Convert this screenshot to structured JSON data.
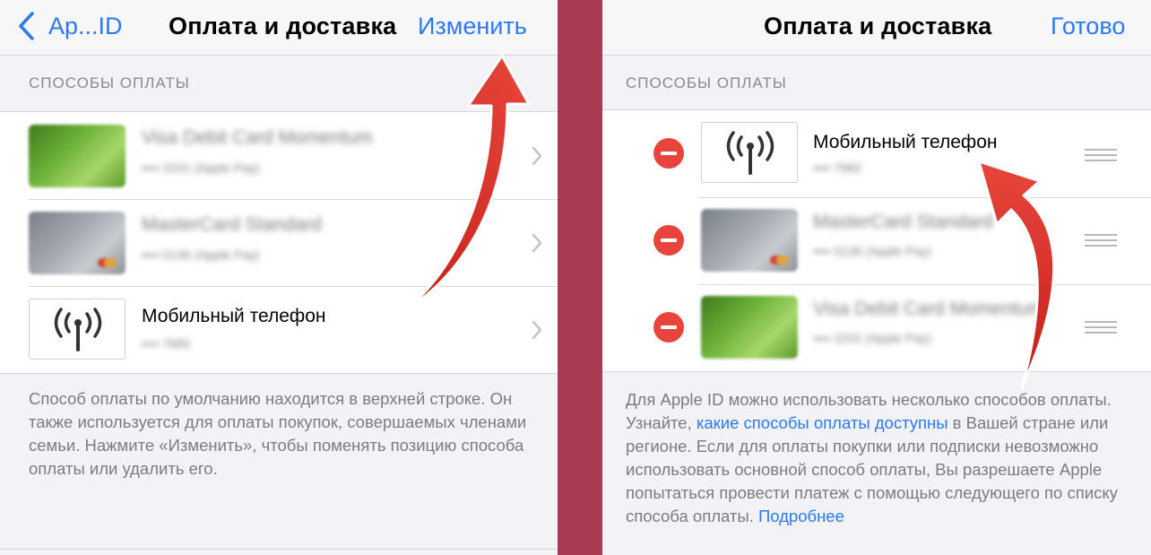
{
  "left": {
    "nav": {
      "back_label": "Ap...ID",
      "title": "Оплата и доставка",
      "action_label": "Изменить"
    },
    "section_header": "СПОСОБЫ ОПЛАТЫ",
    "rows": [
      {
        "title": "Visa Debit Card Momentum",
        "subtitle": "•••• 2201 (Apple Pay)"
      },
      {
        "title": "MasterCard Standard",
        "subtitle": "•••• 0136 (Apple Pay)"
      },
      {
        "title": "Мобильный телефон",
        "subtitle": "•••• 7682"
      }
    ],
    "footer": "Способ оплаты по умолчанию находится в верхней строке. Он также используется для оплаты покупок, совершаемых членами семьи. Нажмите «Изменить», чтобы поменять позицию способа оплаты или удалить его."
  },
  "right": {
    "nav": {
      "title": "Оплата и доставка",
      "action_label": "Готово"
    },
    "section_header": "СПОСОБЫ ОПЛАТЫ",
    "rows": [
      {
        "title": "Мобильный телефон",
        "subtitle": "•••• 7682"
      },
      {
        "title": "MasterCard Standard",
        "subtitle": "•••• 0136 (Apple Pay)"
      },
      {
        "title": "Visa Debit Card Momentum",
        "subtitle": "•••• 2201 (Apple Pay)"
      }
    ],
    "footer": {
      "part1": "Для Apple ID можно использовать несколько способов оплаты. Узнайте, ",
      "link1": "какие способы оплаты доступны",
      "part2": " в Вашей стране или регионе. Если для оплаты покупки или подписки невозможно использовать основной способ оплаты, Вы разрешаете Apple попытаться провести платеж с помощью следующего по списку способа оплаты. ",
      "link2": "Подробнее"
    }
  },
  "colors": {
    "accent": "#2a7af6",
    "divider": "#a83a52",
    "delete": "#e8443b",
    "annotation_arrow": "#d9302a"
  },
  "icons": [
    "chevron-left-icon",
    "chevron-right-icon",
    "antenna-icon",
    "delete-minus-icon",
    "reorder-handle-icon"
  ]
}
